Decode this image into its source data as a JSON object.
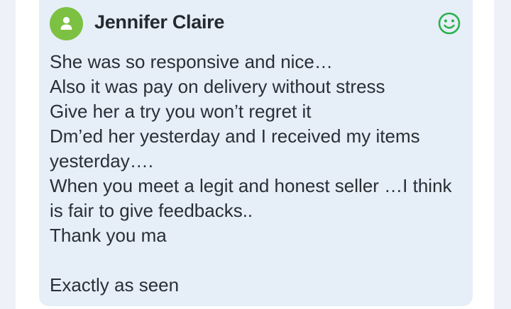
{
  "review": {
    "author": "Jennifer Claire",
    "avatar_icon": "user-icon",
    "avatar_color": "#7cc142",
    "sentiment_icon": "smiley-face-icon",
    "sentiment_color": "#2bb24c",
    "lines": [
      "She was so responsive and nice…",
      "Also it was pay on delivery without stress",
      "Give her a try you won’t regret it",
      "Dm’ed her yesterday and I received my items",
      "yesterday….",
      "When you meet a legit and honest seller …I think",
      "is fair to give feedbacks..",
      "Thank you ma",
      "",
      "Exactly as seen"
    ]
  }
}
